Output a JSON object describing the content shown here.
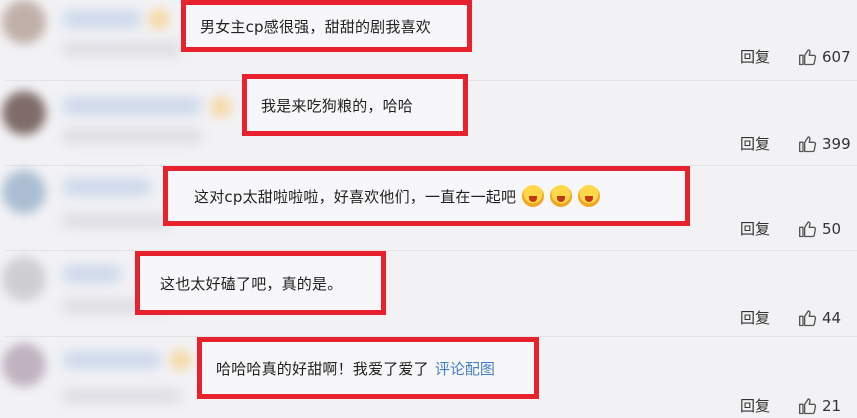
{
  "colors": {
    "highlight_border": "#e8212e",
    "link": "#4a7fc8",
    "background": "#f2f2f5"
  },
  "comments": [
    {
      "text": "男女主cp感很强，甜甜的剧我喜欢",
      "reply_label": "回复",
      "like_count": "607",
      "like_icon": "thumb-up-icon"
    },
    {
      "text": "我是来吃狗粮的，哈哈",
      "reply_label": "回复",
      "like_count": "399",
      "like_icon": "thumb-up-icon"
    },
    {
      "text": "这对cp太甜啦啦啦，好喜欢他们，一直在一起吧",
      "reply_label": "回复",
      "like_count": "50",
      "like_icon": "thumb-up-icon",
      "emojis": [
        "screaming-face-emoji",
        "screaming-face-emoji",
        "screaming-face-emoji"
      ]
    },
    {
      "text": "这也太好磕了吧，真的是。",
      "reply_label": "回复",
      "like_count": "44",
      "like_icon": "thumb-up-icon"
    },
    {
      "text": "哈哈哈真的好甜啊！我爱了爱了",
      "link_text": "评论配图",
      "reply_label": "回复",
      "like_count": "21",
      "like_icon": "thumb-up-icon"
    }
  ]
}
